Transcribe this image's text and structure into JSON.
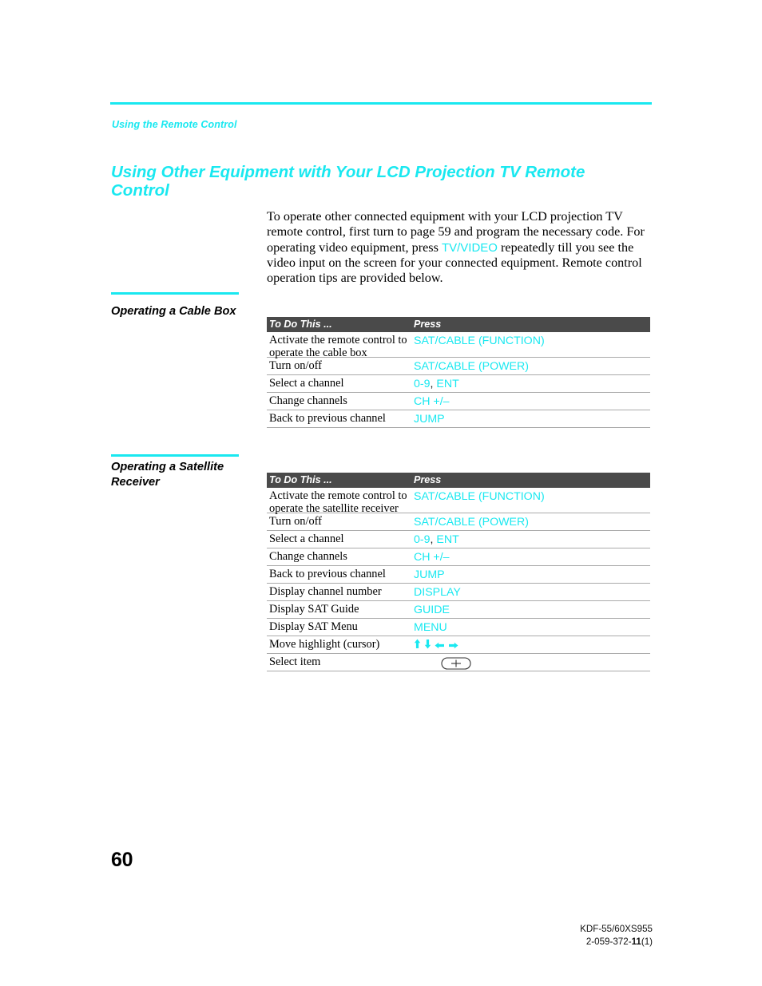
{
  "document": {
    "running_head": "Using the Remote Control",
    "title": "Using Other Equipment with Your LCD Projection TV Remote Control",
    "page_number": "60"
  },
  "intro": {
    "part1": "To operate other connected equipment with your LCD projection TV remote control, first turn to page 59 and program the necessary code. For operating video equipment, press ",
    "key": "TV/VIDEO",
    "part2": " repeatedly till you see the video input on the screen for your connected equipment. Remote control operation tips are provided below."
  },
  "columns": {
    "to_do_this": "To Do This ...",
    "press": "Press"
  },
  "sections": [
    {
      "heading": "Operating a Cable Box",
      "rows": [
        {
          "do": "Activate the remote control to operate the cable box",
          "press": "SAT/CABLE (FUNCTION)",
          "type": "tall"
        },
        {
          "do": "Turn on/off",
          "press": "SAT/CABLE (POWER)",
          "type": "short"
        },
        {
          "do": "Select a channel",
          "press": "0-9, ENT",
          "press_a": "0-9",
          "press_sep": ",",
          "press_b": "ENT",
          "type": "short"
        },
        {
          "do": "Change channels",
          "press": "CH +/–",
          "type": "short"
        },
        {
          "do": "Back to previous channel",
          "press": "JUMP",
          "type": "short"
        }
      ]
    },
    {
      "heading": "Operating a Satellite Receiver",
      "rows": [
        {
          "do": "Activate the remote control to operate the satellite receiver",
          "press": "SAT/CABLE (FUNCTION)",
          "type": "tall"
        },
        {
          "do": "Turn on/off",
          "press": "SAT/CABLE (POWER)",
          "type": "short"
        },
        {
          "do": "Select a channel",
          "press": "0-9, ENT",
          "press_a": "0-9",
          "press_sep": ",",
          "press_b": "ENT",
          "type": "short"
        },
        {
          "do": "Change channels",
          "press": "CH +/–",
          "type": "short"
        },
        {
          "do": "Back to previous channel",
          "press": "JUMP",
          "type": "short"
        },
        {
          "do": "Display channel number",
          "press": "DISPLAY",
          "type": "short"
        },
        {
          "do": "Display SAT Guide",
          "press": "GUIDE",
          "type": "short"
        },
        {
          "do": "Display SAT Menu",
          "press": "MENU",
          "type": "short"
        },
        {
          "do": "Move highlight (cursor)",
          "press": "arrow-up arrow-down arrow-left arrow-right",
          "type": "short"
        },
        {
          "do": "Select item",
          "press": "select-button-icon",
          "type": "short"
        }
      ]
    }
  ],
  "footer": {
    "model": "KDF-55/60XS955",
    "doc_prefix": "2-059-372-",
    "doc_bold": "11",
    "doc_suffix": "(1)"
  },
  "colors": {
    "accent_cyan": "#19e8f0",
    "table_header_bg": "#4a4a4a",
    "rule_gray": "#aaaaaa",
    "text_black": "#000000"
  }
}
